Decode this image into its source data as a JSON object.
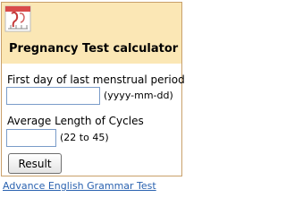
{
  "widget": {
    "logo_icon": "pregnancy-calendar-logo",
    "title": "Pregnancy Test calculator",
    "header_bg": "#fbe7b5",
    "border_color": "#c9a06a"
  },
  "form": {
    "first_day_label": "First day of last menstrual period",
    "first_day_value": "",
    "first_day_hint": "(yyyy-mm-dd)",
    "cycle_label": "Average Length of Cycles",
    "cycle_value": "",
    "cycle_hint": "(22 to 45)",
    "submit_label": "Result"
  },
  "footer": {
    "link_text": "Advance English Grammar Test",
    "link_color": "#2a62b0"
  }
}
